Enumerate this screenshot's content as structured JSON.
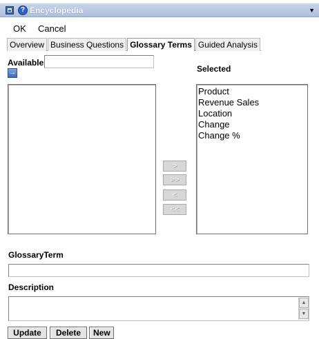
{
  "window": {
    "title": "Encyclopedia",
    "help_icon": "help-circle-icon"
  },
  "menu": {
    "ok": "OK",
    "cancel": "Cancel"
  },
  "tabs": [
    {
      "label": "Overview",
      "active": false
    },
    {
      "label": "Business Questions",
      "active": false
    },
    {
      "label": "Glossary Terms",
      "active": true
    },
    {
      "label": "Guided Analysis",
      "active": false
    }
  ],
  "available": {
    "label": "Available",
    "filter_value": ""
  },
  "selected": {
    "label": "Selected",
    "items": [
      "Product",
      "Revenue Sales",
      "Location",
      "Change",
      "Change %"
    ]
  },
  "move_buttons": {
    "add": ">",
    "add_all": ">>",
    "remove": "<",
    "remove_all": "<<"
  },
  "glossary_term": {
    "label": "GlossaryTerm",
    "value": ""
  },
  "description": {
    "label": "Description",
    "value": ""
  },
  "actions": {
    "update": "Update",
    "delete": "Delete",
    "new": "New"
  }
}
